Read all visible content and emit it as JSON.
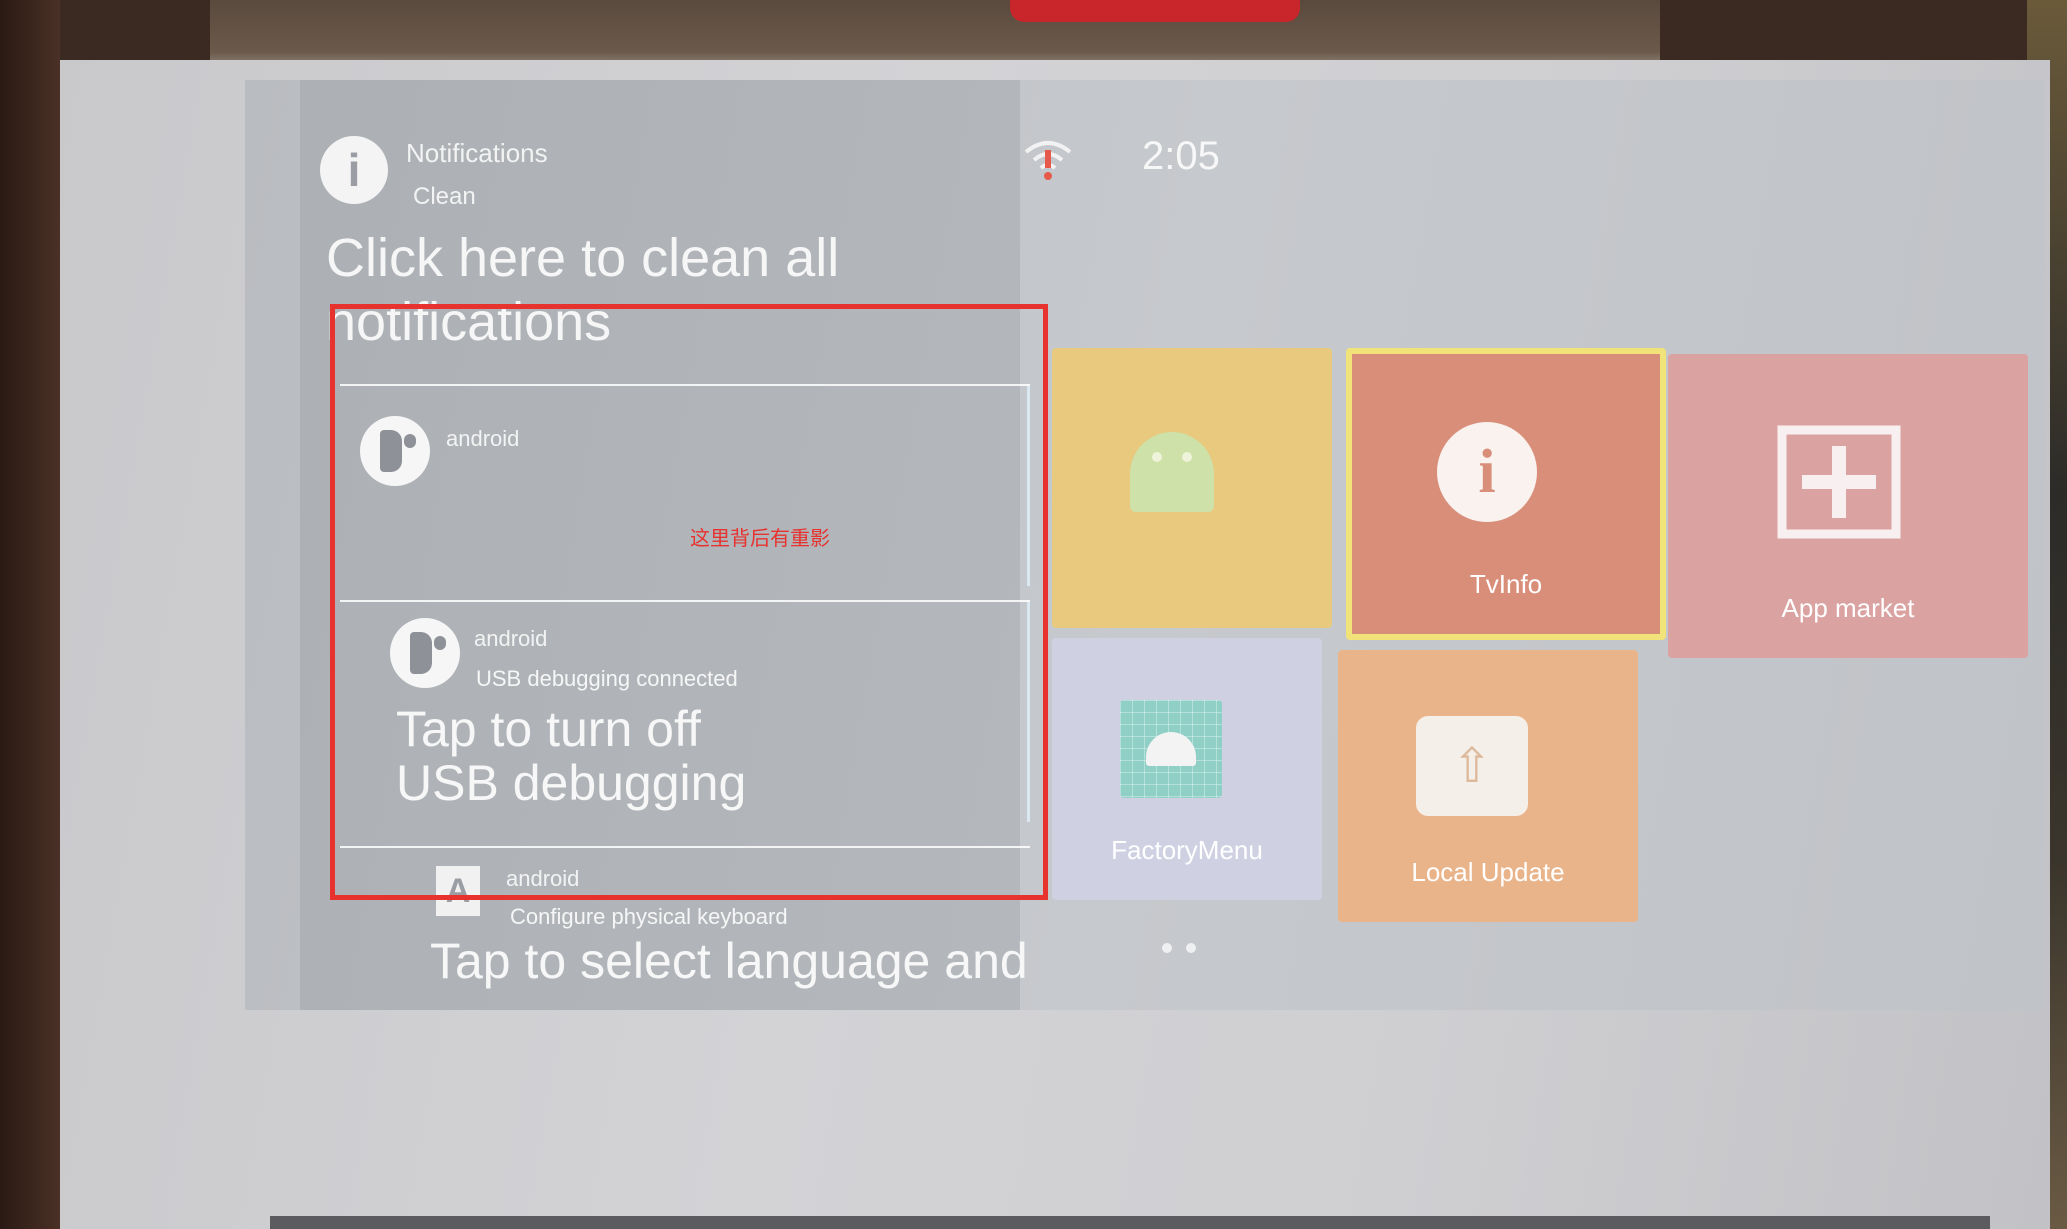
{
  "header": {
    "title": "Notifications",
    "subtitle": "Clean",
    "clean_all": "Click here to clean all notifications",
    "icon": "info-icon"
  },
  "status_bar": {
    "wifi_icon": "wifi-alert-icon",
    "time": "2:05"
  },
  "notifications": [
    {
      "app": "android",
      "icon": "android-app-icon",
      "line": "",
      "body": ""
    },
    {
      "app": "android",
      "icon": "android-app-icon",
      "line": "USB debugging connected",
      "body": "Tap to turn off USB debugging"
    },
    {
      "app": "android",
      "icon": "keyboard-a-icon",
      "line": "Configure physical keyboard",
      "body": "Tap to select language and"
    }
  ],
  "tiles": [
    {
      "label": "",
      "icon": "android-robot-icon",
      "color": "#e9c97e"
    },
    {
      "label": "TvInfo",
      "icon": "info-icon",
      "color": "#d98e7a"
    },
    {
      "label": "App market",
      "icon": "market-plus-icon",
      "color": "#dba2a2"
    },
    {
      "label": "FactoryMenu",
      "icon": "factory-android-icon",
      "color": "#cfd1e3"
    },
    {
      "label": "Local Update",
      "icon": "upload-arrow-icon",
      "color": "#eab48a"
    }
  ],
  "page_indicator": {
    "pages": 2,
    "current": 1
  },
  "annotation": {
    "text": "这里背后有重影",
    "color": "#e8322e"
  },
  "colors": {
    "focus_border": "#f2e27a",
    "annotation_red": "#e8322e"
  }
}
